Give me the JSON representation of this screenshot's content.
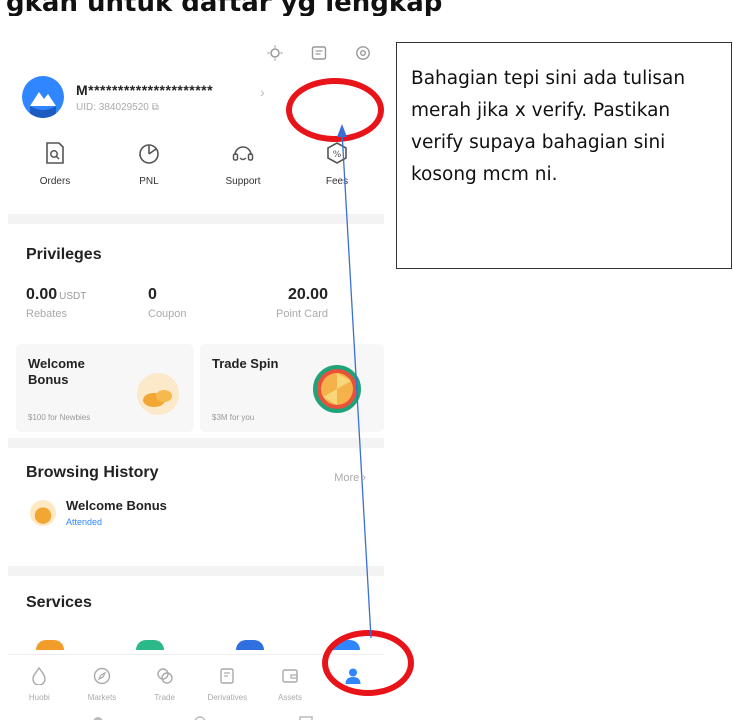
{
  "doc_heading": "gkah untuk daftar yg lengkap",
  "profile": {
    "name": "M*********************",
    "uid": "UID: 384029520"
  },
  "quick_actions": [
    {
      "label": "Orders",
      "icon": "orders-icon"
    },
    {
      "label": "PNL",
      "icon": "pnl-icon"
    },
    {
      "label": "Support",
      "icon": "support-icon"
    },
    {
      "label": "Fees",
      "icon": "fees-icon"
    }
  ],
  "privileges": {
    "title": "Privileges",
    "rebates_value": "0.00",
    "rebates_unit": "USDT",
    "rebates_label": "Rebates",
    "coupon_value": "0",
    "coupon_label": "Coupon",
    "point_value": "20.00",
    "point_label": "Point Card"
  },
  "cards": [
    {
      "title": "Welcome Bonus",
      "sub": "$100 for Newbies"
    },
    {
      "title": "Trade Spin",
      "sub": "$3M for you"
    }
  ],
  "history": {
    "title": "Browsing History",
    "more": "More",
    "item_title": "Welcome Bonus",
    "item_tag": "Attended"
  },
  "services": {
    "title": "Services"
  },
  "tabs": [
    {
      "label": "Huobi",
      "icon": "huobi-icon"
    },
    {
      "label": "Markets",
      "icon": "markets-icon"
    },
    {
      "label": "Trade",
      "icon": "trade-icon"
    },
    {
      "label": "Derivatives",
      "icon": "derivatives-icon"
    },
    {
      "label": "Assets",
      "icon": "assets-icon"
    },
    {
      "label": "",
      "icon": "profile-icon"
    }
  ],
  "callout": {
    "text": "Bahagian tepi sini ada tulisan merah jika x verify. Pastikan verify supaya bahagian sini kosong mcm ni."
  },
  "colors": {
    "accent": "#2f86ff",
    "annotation_red": "#e8141a",
    "arrow_blue": "#3b6fd6"
  }
}
